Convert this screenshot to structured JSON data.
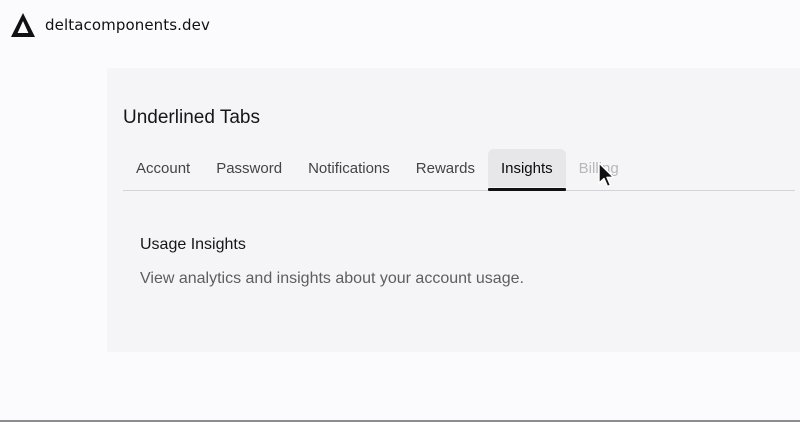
{
  "site": {
    "name": "deltacomponents.dev",
    "logo_icon": "delta-triangle-icon"
  },
  "demo": {
    "title": "Underlined Tabs",
    "tabs": [
      {
        "label": "Account",
        "state": "normal"
      },
      {
        "label": "Password",
        "state": "normal"
      },
      {
        "label": "Notifications",
        "state": "normal"
      },
      {
        "label": "Rewards",
        "state": "normal"
      },
      {
        "label": "Insights",
        "state": "active"
      },
      {
        "label": "Billing",
        "state": "disabled"
      }
    ],
    "content": {
      "title": "Usage Insights",
      "description": "View analytics and insights about your account usage."
    }
  },
  "colors": {
    "page_background": "#fbfbfd",
    "panel_background": "#f5f5f7",
    "active_tab_background": "#e7e7ea",
    "active_underline": "#111111",
    "disabled_text": "#b8b8bc"
  }
}
